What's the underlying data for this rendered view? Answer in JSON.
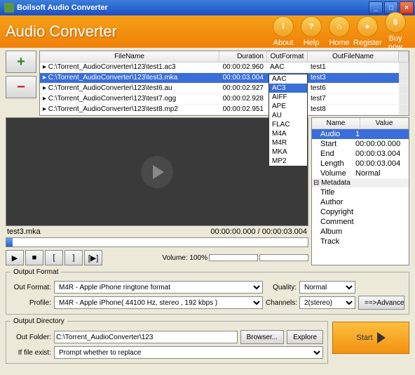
{
  "window": {
    "title": "Boilsoft Audio Converter"
  },
  "header": {
    "title": "Audio Converter",
    "buttons": [
      "About",
      "Help",
      "Home",
      "Register",
      "Buy now"
    ],
    "icons": [
      "i",
      "?",
      "⌂",
      "🔑",
      "$"
    ]
  },
  "table": {
    "cols": [
      "FileName",
      "Duration",
      "OutFormat",
      "OutFileName"
    ],
    "rows": [
      {
        "file": "C:\\Torrent_AudioConverter\\123\\test1.ac3",
        "dur": "00:00:02.960",
        "fmt": "AAC",
        "out": "test1"
      },
      {
        "file": "C:\\Torrent_AudioConverter\\123\\test3.mka",
        "dur": "00:00:03.004",
        "fmt": "M4R",
        "out": "test3",
        "sel": true
      },
      {
        "file": "C:\\Torrent_AudioConverter\\123\\test6.au",
        "dur": "00:00:02.927",
        "fmt": "",
        "out": "test6"
      },
      {
        "file": "C:\\Torrent_AudioConverter\\123\\test7.ogg",
        "dur": "00:00:02.928",
        "fmt": "",
        "out": "test7"
      },
      {
        "file": "C:\\Torrent_AudioConverter\\123\\test8.mp2",
        "dur": "00:00:02.951",
        "fmt": "",
        "out": "test8"
      }
    ]
  },
  "formats": [
    "AAC",
    "AC3",
    "AIFF",
    "APE",
    "AU",
    "FLAC",
    "M4A",
    "M4R",
    "MKA",
    "MP2"
  ],
  "formats_sel": "AC3",
  "player": {
    "file": "test3.mka",
    "time": "00:00:00.000 / 00:00:03.004",
    "volume": "Volume: 100%"
  },
  "props": {
    "cols": [
      "Name",
      "Value"
    ],
    "rows": [
      {
        "k": "Audio",
        "v": "1",
        "sel": true
      },
      {
        "k": "Start",
        "v": "00:00:00.000"
      },
      {
        "k": "End",
        "v": "00:00:03.004"
      },
      {
        "k": "Length",
        "v": "00:00:03.004"
      },
      {
        "k": "Volume",
        "v": "Normal"
      }
    ],
    "group": "Metadata",
    "meta": [
      "Title",
      "Author",
      "Copyright",
      "Comment",
      "Album",
      "Track"
    ]
  },
  "output": {
    "legend": "Output Format",
    "format_lbl": "Out Format:",
    "format_val": "M4R - Apple iPhone ringtone format",
    "profile_lbl": "Profile:",
    "profile_val": "M4R - Apple iPhone( 44100 Hz, stereo , 192 kbps )",
    "quality_lbl": "Quality:",
    "quality_val": "Normal",
    "channels_lbl": "Channels:",
    "channels_val": "2(stereo)",
    "advance": "==>Advance"
  },
  "dir": {
    "legend": "Output Directory",
    "folder_lbl": "Out Folder:",
    "folder_val": "C:\\Torrent_AudioConverter\\123",
    "browse": "Browser...",
    "explore": "Explore",
    "exist_lbl": "If file exist:",
    "exist_val": "Prompt whether to replace"
  },
  "start": "Start"
}
